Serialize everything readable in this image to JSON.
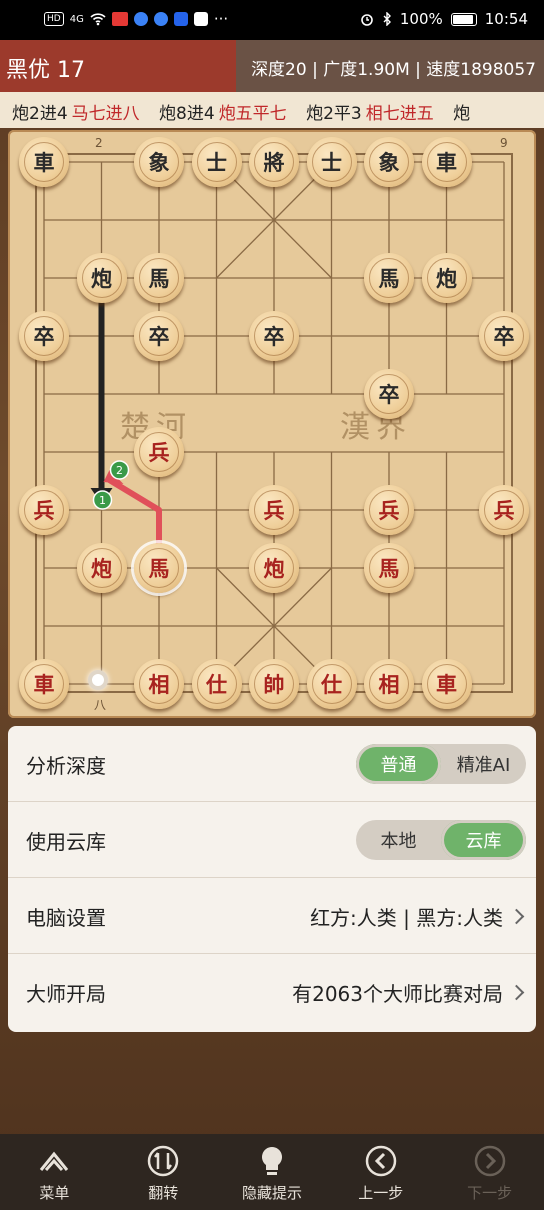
{
  "status_bar": {
    "hd_label": "HD",
    "net_label": "4G",
    "battery_text": "100%",
    "time": "10:54"
  },
  "eval_bar": {
    "advantage": "黑优 17",
    "stats": "深度20 | 广度1.90M | 速度1898057"
  },
  "move_line": [
    {
      "black": "炮2进4",
      "red": "马七进八"
    },
    {
      "black": "炮8进4",
      "red": "炮五平七"
    },
    {
      "black": "炮2平3",
      "red": "相七进五"
    },
    {
      "black": "炮",
      "red": ""
    }
  ],
  "board": {
    "top_file_labels": [
      {
        "text": "2"
      },
      {
        "text": "9"
      }
    ],
    "bottom_file_labels": [
      {
        "text": "八"
      }
    ],
    "river": {
      "left": "楚河",
      "right": "漢界"
    },
    "arrow_badges": [
      "1",
      "2"
    ],
    "pieces": [
      {
        "side": "b",
        "char": "車",
        "file": 0,
        "rank": 0
      },
      {
        "side": "b",
        "char": "象",
        "file": 2,
        "rank": 0
      },
      {
        "side": "b",
        "char": "士",
        "file": 3,
        "rank": 0
      },
      {
        "side": "b",
        "char": "將",
        "file": 4,
        "rank": 0
      },
      {
        "side": "b",
        "char": "士",
        "file": 5,
        "rank": 0
      },
      {
        "side": "b",
        "char": "象",
        "file": 6,
        "rank": 0
      },
      {
        "side": "b",
        "char": "車",
        "file": 7,
        "rank": 0
      },
      {
        "side": "b",
        "char": "炮",
        "file": 1,
        "rank": 2
      },
      {
        "side": "b",
        "char": "馬",
        "file": 2,
        "rank": 2
      },
      {
        "side": "b",
        "char": "馬",
        "file": 6,
        "rank": 2
      },
      {
        "side": "b",
        "char": "炮",
        "file": 7,
        "rank": 2
      },
      {
        "side": "b",
        "char": "卒",
        "file": 0,
        "rank": 3
      },
      {
        "side": "b",
        "char": "卒",
        "file": 2,
        "rank": 3
      },
      {
        "side": "b",
        "char": "卒",
        "file": 4,
        "rank": 3
      },
      {
        "side": "b",
        "char": "卒",
        "file": 8,
        "rank": 3
      },
      {
        "side": "b",
        "char": "卒",
        "file": 6,
        "rank": 4
      },
      {
        "side": "r",
        "char": "兵",
        "file": 2,
        "rank": 5
      },
      {
        "side": "r",
        "char": "兵",
        "file": 0,
        "rank": 6
      },
      {
        "side": "r",
        "char": "兵",
        "file": 4,
        "rank": 6
      },
      {
        "side": "r",
        "char": "兵",
        "file": 6,
        "rank": 6
      },
      {
        "side": "r",
        "char": "兵",
        "file": 8,
        "rank": 6
      },
      {
        "side": "r",
        "char": "炮",
        "file": 1,
        "rank": 7
      },
      {
        "side": "r",
        "char": "馬",
        "file": 2,
        "rank": 7,
        "selected": true
      },
      {
        "side": "r",
        "char": "炮",
        "file": 4,
        "rank": 7
      },
      {
        "side": "r",
        "char": "馬",
        "file": 6,
        "rank": 7
      },
      {
        "side": "r",
        "char": "車",
        "file": 0,
        "rank": 9
      },
      {
        "side": "r",
        "char": "相",
        "file": 2,
        "rank": 9
      },
      {
        "side": "r",
        "char": "仕",
        "file": 3,
        "rank": 9
      },
      {
        "side": "r",
        "char": "帥",
        "file": 4,
        "rank": 9
      },
      {
        "side": "r",
        "char": "仕",
        "file": 5,
        "rank": 9
      },
      {
        "side": "r",
        "char": "相",
        "file": 6,
        "rank": 9
      },
      {
        "side": "r",
        "char": "車",
        "file": 7,
        "rank": 9
      }
    ]
  },
  "panel": {
    "depth": {
      "label": "分析深度",
      "options": [
        "普通",
        "精准AI"
      ],
      "selected": 0
    },
    "cloud": {
      "label": "使用云库",
      "options": [
        "本地",
        "云库"
      ],
      "selected": 1
    },
    "computer": {
      "label": "电脑设置",
      "value": "红方:人类 | 黑方:人类"
    },
    "master": {
      "label": "大师开局",
      "value": "有2063个大师比赛对局"
    }
  },
  "nav": [
    {
      "label": "菜单",
      "icon": "menu-icon"
    },
    {
      "label": "翻转",
      "icon": "flip-icon"
    },
    {
      "label": "隐藏提示",
      "icon": "bulb-icon"
    },
    {
      "label": "上一步",
      "icon": "prev-icon"
    },
    {
      "label": "下一步",
      "icon": "next-icon",
      "disabled": true
    }
  ]
}
